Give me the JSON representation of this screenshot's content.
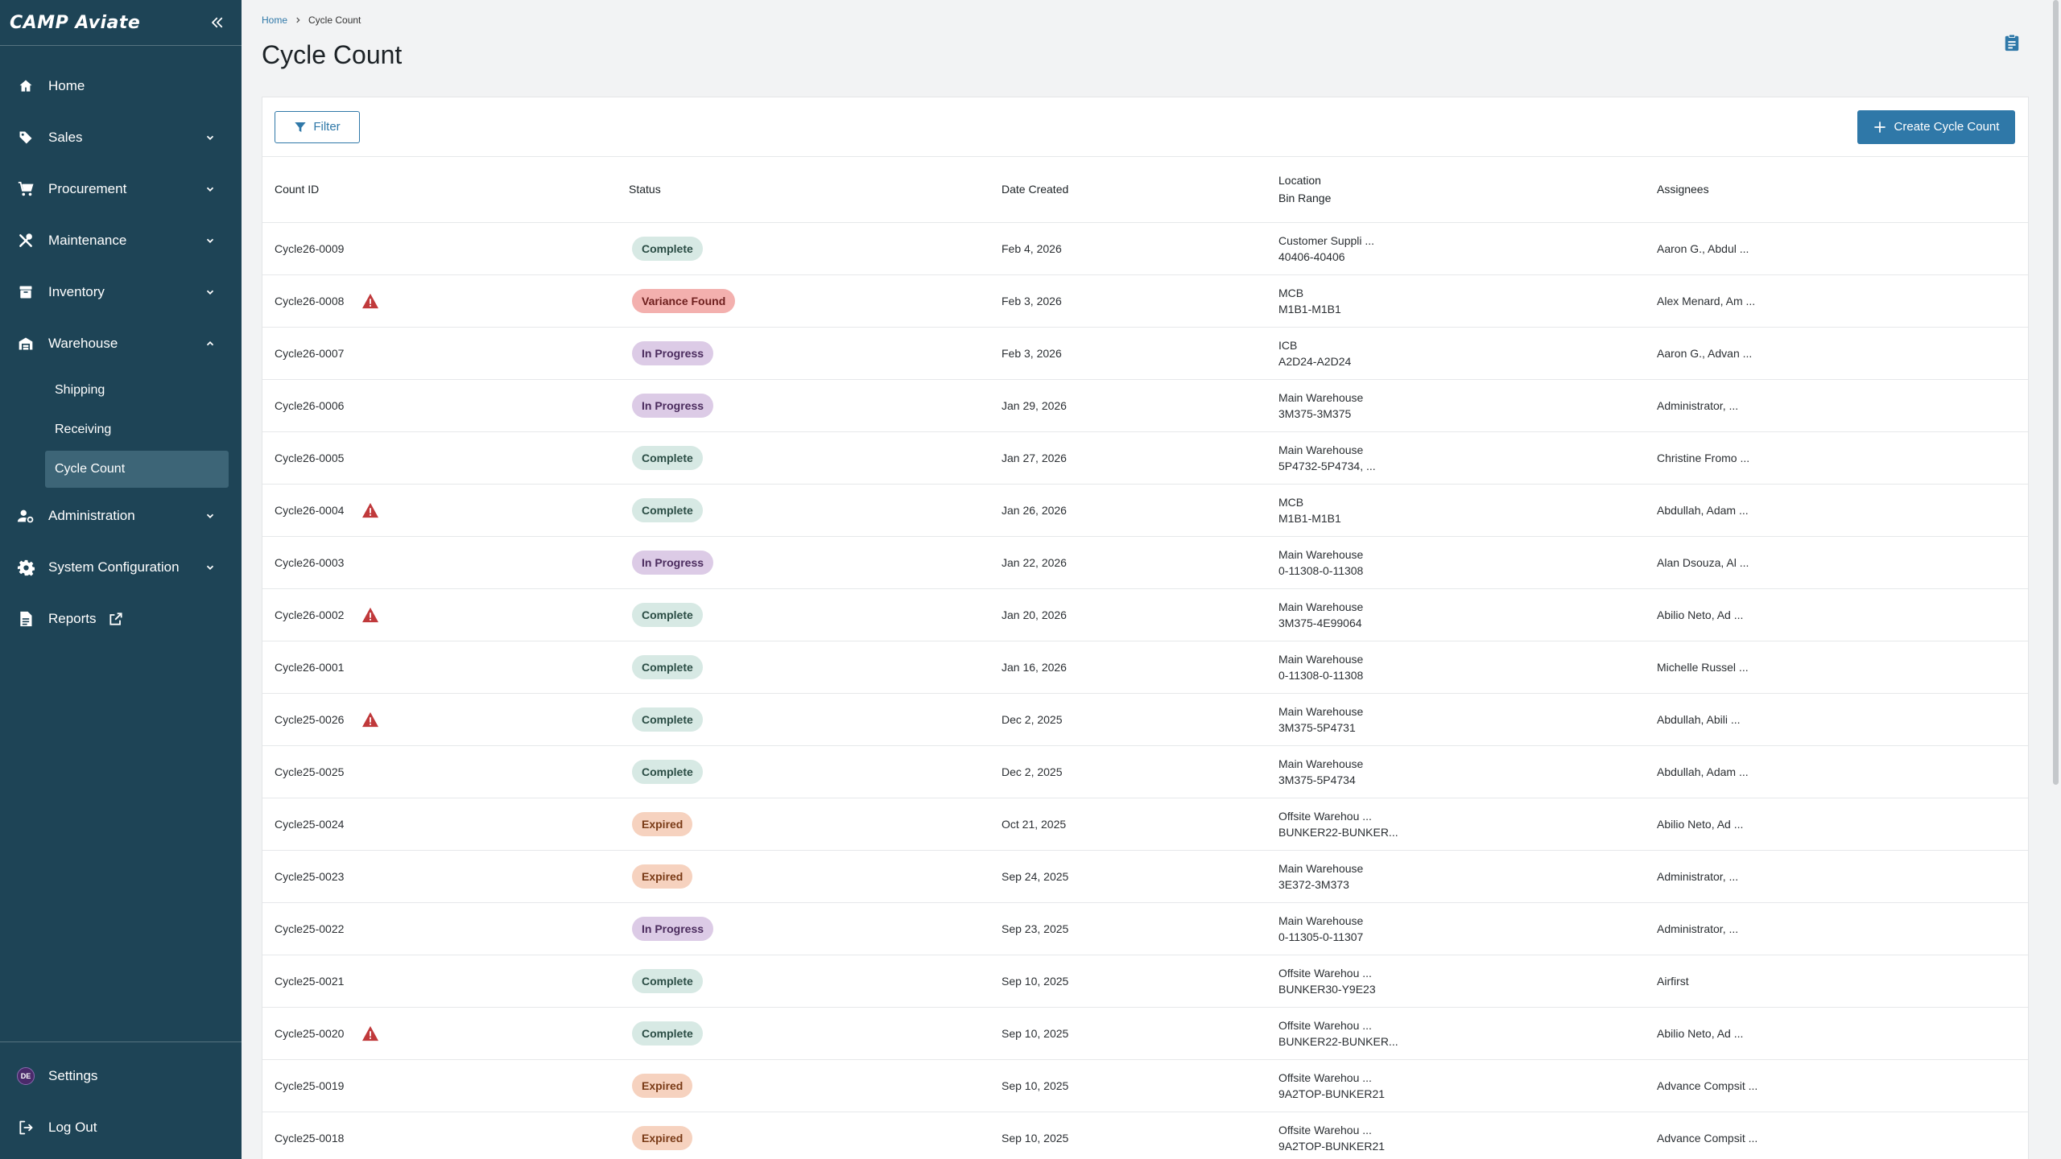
{
  "app": {
    "logo_text": "CAMP Aviate"
  },
  "sidebar": {
    "items": [
      {
        "label": "Home",
        "icon": "home-icon",
        "expandable": false
      },
      {
        "label": "Sales",
        "icon": "tag-icon",
        "expandable": true
      },
      {
        "label": "Procurement",
        "icon": "cart-icon",
        "expandable": true
      },
      {
        "label": "Maintenance",
        "icon": "tools-icon",
        "expandable": true
      },
      {
        "label": "Inventory",
        "icon": "inventory-icon",
        "expandable": true
      },
      {
        "label": "Warehouse",
        "icon": "warehouse-icon",
        "expandable": true,
        "expanded": true
      },
      {
        "label": "Administration",
        "icon": "admin-icon",
        "expandable": true
      },
      {
        "label": "System Configuration",
        "icon": "gear-icon",
        "expandable": true
      },
      {
        "label": "Reports",
        "icon": "document-icon",
        "external": true
      }
    ],
    "warehouse_sub": [
      {
        "label": "Shipping"
      },
      {
        "label": "Receiving"
      },
      {
        "label": "Cycle Count",
        "active": true
      }
    ],
    "bottom": {
      "settings_label": "Settings",
      "avatar_initials": "DE",
      "logout_label": "Log Out"
    }
  },
  "breadcrumb": {
    "home": "Home",
    "current": "Cycle Count"
  },
  "page": {
    "title": "Cycle Count"
  },
  "toolbar": {
    "filter_label": "Filter",
    "create_label": "Create Cycle Count"
  },
  "table": {
    "headers": {
      "count_id": "Count ID",
      "status": "Status",
      "date_created": "Date Created",
      "location": "Location",
      "bin_range": "Bin Range",
      "assignees": "Assignees"
    },
    "rows": [
      {
        "id": "Cycle26-0009",
        "warning": false,
        "status": "Complete",
        "status_type": "complete",
        "date": "Feb 4, 2026",
        "location": "Customer Suppli ...",
        "bin_range": "40406-40406",
        "assignees": "Aaron G., Abdul ..."
      },
      {
        "id": "Cycle26-0008",
        "warning": true,
        "status": "Variance Found",
        "status_type": "variance",
        "date": "Feb 3, 2026",
        "location": "MCB",
        "bin_range": "M1B1-M1B1",
        "assignees": "Alex Menard, Am ..."
      },
      {
        "id": "Cycle26-0007",
        "warning": false,
        "status": "In Progress",
        "status_type": "progress",
        "date": "Feb 3, 2026",
        "location": "ICB",
        "bin_range": "A2D24-A2D24",
        "assignees": "Aaron G., Advan ..."
      },
      {
        "id": "Cycle26-0006",
        "warning": false,
        "status": "In Progress",
        "status_type": "progress",
        "date": "Jan 29, 2026",
        "location": "Main Warehouse",
        "bin_range": "3M375-3M375",
        "assignees": "Administrator, ..."
      },
      {
        "id": "Cycle26-0005",
        "warning": false,
        "status": "Complete",
        "status_type": "complete",
        "date": "Jan 27, 2026",
        "location": "Main Warehouse",
        "bin_range": "5P4732-5P4734, ...",
        "assignees": "Christine Fromo ..."
      },
      {
        "id": "Cycle26-0004",
        "warning": true,
        "status": "Complete",
        "status_type": "complete",
        "date": "Jan 26, 2026",
        "location": "MCB",
        "bin_range": "M1B1-M1B1",
        "assignees": "Abdullah, Adam ..."
      },
      {
        "id": "Cycle26-0003",
        "warning": false,
        "status": "In Progress",
        "status_type": "progress",
        "date": "Jan 22, 2026",
        "location": "Main Warehouse",
        "bin_range": "0-11308-0-11308",
        "assignees": "Alan Dsouza, Al ..."
      },
      {
        "id": "Cycle26-0002",
        "warning": true,
        "status": "Complete",
        "status_type": "complete",
        "date": "Jan 20, 2026",
        "location": "Main Warehouse",
        "bin_range": "3M375-4E99064",
        "assignees": "Abilio Neto, Ad ..."
      },
      {
        "id": "Cycle26-0001",
        "warning": false,
        "status": "Complete",
        "status_type": "complete",
        "date": "Jan 16, 2026",
        "location": "Main Warehouse",
        "bin_range": "0-11308-0-11308",
        "assignees": "Michelle Russel ..."
      },
      {
        "id": "Cycle25-0026",
        "warning": true,
        "status": "Complete",
        "status_type": "complete",
        "date": "Dec 2, 2025",
        "location": "Main Warehouse",
        "bin_range": "3M375-5P4731",
        "assignees": "Abdullah, Abili ..."
      },
      {
        "id": "Cycle25-0025",
        "warning": false,
        "status": "Complete",
        "status_type": "complete",
        "date": "Dec 2, 2025",
        "location": "Main Warehouse",
        "bin_range": "3M375-5P4734",
        "assignees": "Abdullah, Adam ..."
      },
      {
        "id": "Cycle25-0024",
        "warning": false,
        "status": "Expired",
        "status_type": "expired",
        "date": "Oct 21, 2025",
        "location": "Offsite Warehou ...",
        "bin_range": "BUNKER22-BUNKER...",
        "assignees": "Abilio Neto, Ad ..."
      },
      {
        "id": "Cycle25-0023",
        "warning": false,
        "status": "Expired",
        "status_type": "expired",
        "date": "Sep 24, 2025",
        "location": "Main Warehouse",
        "bin_range": "3E372-3M373",
        "assignees": "Administrator, ..."
      },
      {
        "id": "Cycle25-0022",
        "warning": false,
        "status": "In Progress",
        "status_type": "progress",
        "date": "Sep 23, 2025",
        "location": "Main Warehouse",
        "bin_range": "0-11305-0-11307",
        "assignees": "Administrator, ..."
      },
      {
        "id": "Cycle25-0021",
        "warning": false,
        "status": "Complete",
        "status_type": "complete",
        "date": "Sep 10, 2025",
        "location": "Offsite Warehou ...",
        "bin_range": "BUNKER30-Y9E23",
        "assignees": "Airfirst"
      },
      {
        "id": "Cycle25-0020",
        "warning": true,
        "status": "Complete",
        "status_type": "complete",
        "date": "Sep 10, 2025",
        "location": "Offsite Warehou ...",
        "bin_range": "BUNKER22-BUNKER...",
        "assignees": "Abilio Neto, Ad ..."
      },
      {
        "id": "Cycle25-0019",
        "warning": false,
        "status": "Expired",
        "status_type": "expired",
        "date": "Sep 10, 2025",
        "location": "Offsite Warehou ...",
        "bin_range": "9A2TOP-BUNKER21",
        "assignees": "Advance Compsit ..."
      },
      {
        "id": "Cycle25-0018",
        "warning": false,
        "status": "Expired",
        "status_type": "expired",
        "date": "Sep 10, 2025",
        "location": "Offsite Warehou ...",
        "bin_range": "9A2TOP-BUNKER21",
        "assignees": "Advance Compsit ..."
      }
    ]
  },
  "colors": {
    "sidebar_bg": "#1e4456",
    "accent": "#2f78a8",
    "warning": "#c0393b"
  }
}
